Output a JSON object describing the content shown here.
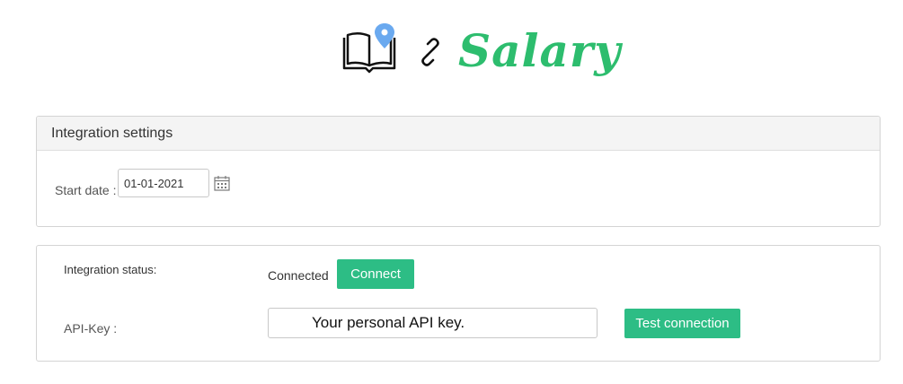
{
  "header": {
    "logo_icons": [
      "book-map-pin-icon",
      "chain-link-icon"
    ],
    "brand_text": "Salary",
    "brand_color": "#2dbd6e"
  },
  "settings_panel": {
    "title": "Integration settings",
    "start_date_label": "Start date :",
    "start_date_value": "01-01-2021",
    "calendar_icon": "calendar-icon"
  },
  "status_panel": {
    "integration_status_label": "Integration status:",
    "integration_status_value": "Connected",
    "connect_button_label": "Connect",
    "api_key_label": "API-Key :",
    "api_key_placeholder": "Your personal API key.",
    "test_connection_button_label": "Test connection",
    "accent_color": "#2dbd85"
  }
}
